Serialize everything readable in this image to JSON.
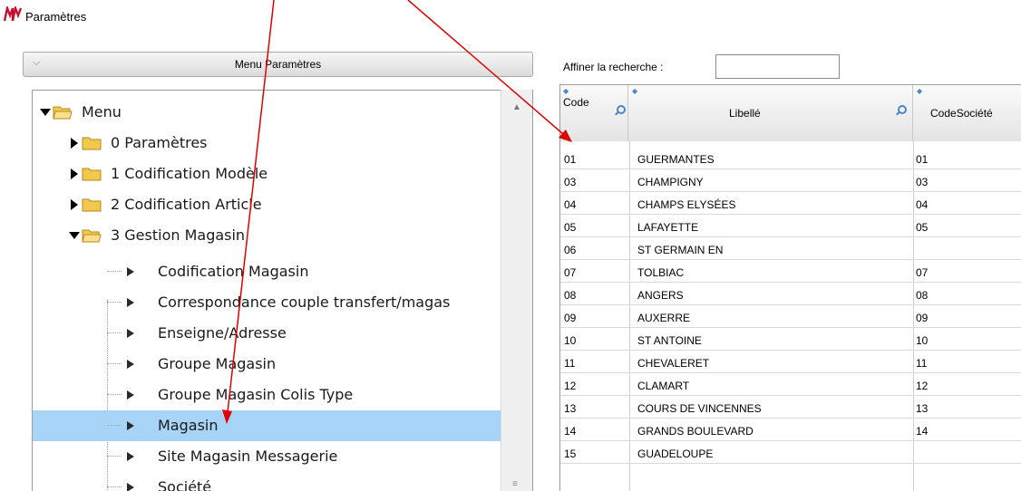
{
  "window": {
    "title": "Paramètres",
    "logo": "app-logo-icon"
  },
  "menu_panel": {
    "header_label": "Menu Paramètres",
    "collapse_icon": "double-chevron-down-icon",
    "tree": [
      {
        "label": "Menu",
        "level": 0,
        "expanded": true
      },
      {
        "label": "0 Paramètres",
        "level": 1,
        "expanded": false
      },
      {
        "label": "1 Codification Modèle",
        "level": 1,
        "expanded": false
      },
      {
        "label": "2 Codification Article",
        "level": 1,
        "expanded": false
      },
      {
        "label": "3 Gestion Magasin",
        "level": 1,
        "expanded": true
      },
      {
        "label": "Codification Magasin",
        "level": 2
      },
      {
        "label": "Correspondance couple transfert/magas",
        "level": 2
      },
      {
        "label": "Enseigne/Adresse",
        "level": 2
      },
      {
        "label": "Groupe Magasin",
        "level": 2
      },
      {
        "label": "Groupe Magasin Colis Type",
        "level": 2
      },
      {
        "label": "Magasin",
        "level": 2,
        "selected": true
      },
      {
        "label": "Site Magasin Messagerie",
        "level": 2
      },
      {
        "label": "Société",
        "level": 2
      }
    ]
  },
  "search": {
    "label": "Affiner la recherche :",
    "value": ""
  },
  "table": {
    "columns": [
      "Code",
      "Libellé",
      "CodeSociété"
    ],
    "rows": [
      [
        "01",
        "GUERMANTES",
        "01"
      ],
      [
        "03",
        "CHAMPIGNY",
        "03"
      ],
      [
        "04",
        "CHAMPS ELYSÉES",
        "04"
      ],
      [
        "05",
        "LAFAYETTE",
        "05"
      ],
      [
        "06",
        "ST GERMAIN EN",
        ""
      ],
      [
        "07",
        "TOLBIAC",
        "07"
      ],
      [
        "08",
        "ANGERS",
        "08"
      ],
      [
        "09",
        "AUXERRE",
        "09"
      ],
      [
        "10",
        "ST ANTOINE",
        "10"
      ],
      [
        "11",
        "CHEVALERET",
        "11"
      ],
      [
        "12",
        "CLAMART",
        "12"
      ],
      [
        "13",
        "COURS DE VINCENNES",
        "13"
      ],
      [
        "14",
        "GRANDS BOULEVARD",
        "14"
      ],
      [
        "15",
        "GUADELOUPE",
        ""
      ]
    ]
  },
  "colors": {
    "selection": "#a8d4f7",
    "annotation_arrow": "#e00000",
    "folder": "#f2c94c"
  }
}
